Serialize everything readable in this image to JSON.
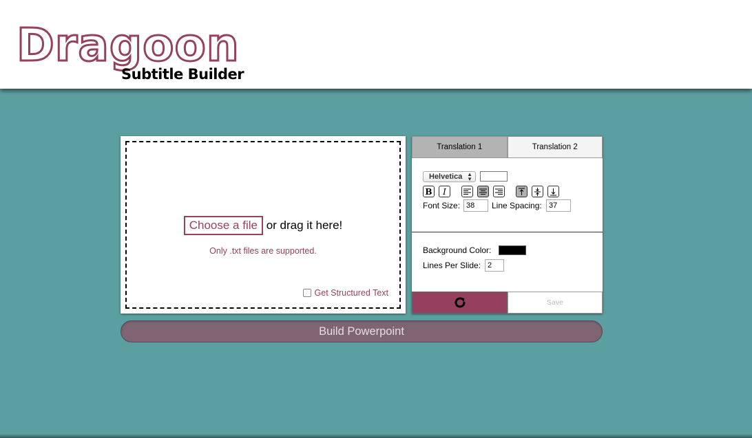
{
  "header": {
    "logo_title": "Dragoon",
    "logo_subtitle": "Subtitle Builder"
  },
  "upload": {
    "choose_label": "Choose a file",
    "drag_text": "or drag it here!",
    "supported_note": "Only .txt files are supported.",
    "structured_label": "Get Structured Text",
    "structured_checked": false
  },
  "settings": {
    "tabs": [
      {
        "label": "Translation 1",
        "active": true
      },
      {
        "label": "Translation 2",
        "active": false
      }
    ],
    "font": {
      "family_selected": "Helvetica",
      "text_color": "#ffffff",
      "bold_label": "B",
      "italic_label": "I",
      "alignment_selected": "center",
      "vertical_alignment_selected": "top"
    },
    "font_size_label": "Font Size:",
    "font_size_value": "38",
    "line_spacing_label": "Line Spacing:",
    "line_spacing_value": "37",
    "background_color_label": "Background Color:",
    "background_color": "#000000",
    "lines_per_slide_label": "Lines Per Slide:",
    "lines_per_slide_value": "2",
    "refresh_icon": "refresh-icon",
    "save_label": "Save"
  },
  "build_label": "Build Powerpoint",
  "colors": {
    "accent": "#96405f",
    "background": "#5c9fa0",
    "build_button": "#7f6574"
  }
}
